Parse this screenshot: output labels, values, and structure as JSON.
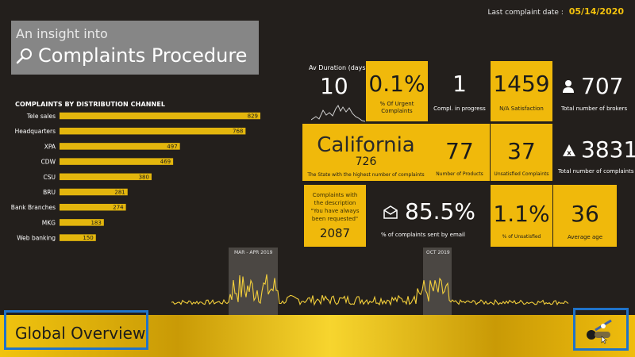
{
  "header": {
    "last_date_label": "Last complaint date :",
    "last_date_value": "05/14/2020",
    "title_line1": "An insight into",
    "title_line2": "Complaints Procedure"
  },
  "chart_data": {
    "type": "bar",
    "title": "COMPLAINTS BY DISTRIBUTION CHANNEL",
    "categories": [
      "Tele sales",
      "Headquarters",
      "XPA",
      "CDW",
      "CSU",
      "BRU",
      "Bank Branches",
      "MKG",
      "Web banking"
    ],
    "values": [
      829,
      768,
      497,
      469,
      380,
      281,
      274,
      183,
      150
    ],
    "xlim": [
      0,
      829
    ],
    "bar_color": "#e3b60d"
  },
  "kpis": {
    "av_duration_label": "Av Duration (days)",
    "av_duration_value": "10",
    "urgent_value": "0.1%",
    "urgent_label": "% Of Urgent Complaints",
    "in_progress_value": "1",
    "in_progress_label": "Compl. in progress",
    "na_satisfaction_value": "1459",
    "na_satisfaction_label": "N/A Satisfaction",
    "brokers_value": "707",
    "brokers_label": "Total number of brokers",
    "state_name": "California",
    "state_value": "726",
    "state_label": "The State with the highest number of complaints",
    "products_value": "77",
    "products_label": "Number of Products",
    "unsatisfied_value": "37",
    "unsatisfied_label": "Unsatisfied Complaints",
    "total_complaints_value": "3831",
    "total_complaints_label": "Total number of complaints",
    "description_text": "Complaints with the description \"You have always been requested\"",
    "description_value": "2087",
    "email_value": "85.5%",
    "email_label": "% of complaints sent by email",
    "unsatisfied_pct_value": "1.1%",
    "unsatisfied_pct_label": "% of Unsatisfied",
    "avg_age_value": "36",
    "avg_age_label": "Average age"
  },
  "timeline": {
    "highlight1_label": "MAR - APR 2019",
    "highlight2_label": "OCT 2019"
  },
  "footer": {
    "global_overview": "Global Overview"
  },
  "colors": {
    "accent_yellow": "#f0b90b",
    "background": "#231f1c",
    "highlight_border": "#1f73c9"
  }
}
